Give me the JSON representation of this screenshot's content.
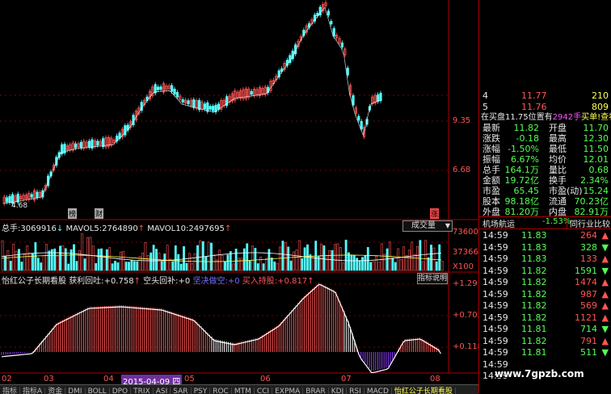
{
  "price_axis": {
    "labels": [
      "9.35",
      "6.68"
    ],
    "low_marker": "4.68"
  },
  "markers": [
    "榜",
    "财",
    "涨"
  ],
  "volume": {
    "header": {
      "total_label": "总手:",
      "total": "3069916",
      "ma5_label": "MAVOL5:",
      "ma5": "2764890",
      "ma10_label": "MAVOL10:",
      "ma10": "2497695"
    },
    "dropdown": "成交量",
    "axis": [
      "73600",
      "37366",
      "X100"
    ]
  },
  "indicator": {
    "header": {
      "name": "怡红公子长期看股",
      "a_label": "获利回吐:",
      "a_val": "+0.758",
      "b_label": "空头回补:",
      "b_val": "+0",
      "c_label": "坚决做空:",
      "c_val": "+0",
      "d_label": "买入持股:",
      "d_val": "+0.817"
    },
    "explain_button": "指标说明",
    "axis": [
      "+1.29",
      "+0.703",
      "+0.118"
    ]
  },
  "date_axis": {
    "labels": [
      "02",
      "03",
      "04",
      "2015-04-09 四",
      "05",
      "06",
      "07",
      "08"
    ]
  },
  "bottom_tabs": [
    "指标",
    "指标A",
    "资金",
    "DMI",
    "BOLL",
    "DPO",
    "TRIX",
    "ASI",
    "SAR",
    "PSY",
    "ROC",
    "MTM",
    "CCI",
    "EXPMA",
    "BRAR",
    "KDJ",
    "RSI",
    "MACD",
    "怡红公子长期看股"
  ],
  "quote": {
    "order_book": [
      {
        "level": "4",
        "price": "11.77",
        "vol": "210"
      },
      {
        "level": "5",
        "price": "11.76",
        "vol": "809"
      }
    ],
    "pending": {
      "text": "在买盘11.75位置有",
      "vol": "2942手",
      "action": "买单!",
      "link": "查看详细"
    },
    "stats": [
      {
        "l1": "最新",
        "v1": "11.82",
        "l2": "开盘",
        "v2": "11.70"
      },
      {
        "l1": "涨跌",
        "v1": "-0.18",
        "l2": "最高",
        "v2": "12.30"
      },
      {
        "l1": "涨幅",
        "v1": "-1.50%",
        "l2": "最低",
        "v2": "11.50"
      },
      {
        "l1": "振幅",
        "v1": "6.67%",
        "l2": "均价",
        "v2": "12.01"
      },
      {
        "l1": "总手",
        "v1": "164.1万",
        "l2": "量比",
        "v2": "0.68"
      },
      {
        "l1": "金额",
        "v1": "19.72亿",
        "l2": "换手",
        "v2": "2.34%"
      },
      {
        "l1": "市盈",
        "v1": "65.45",
        "l2": "市盈(动)",
        "v2": "15.24"
      },
      {
        "l1": "股本",
        "v1": "98.18亿",
        "l2": "流通",
        "v2": "70.23亿"
      },
      {
        "l1": "外盘",
        "v1": "81.20万",
        "l2": "内盘",
        "v2": "82.91万"
      }
    ],
    "sector": {
      "name": "机场航运",
      "change": "-1.53%",
      "compare": "同行业比较"
    },
    "ticks": [
      {
        "time": "14:59",
        "price": "11.83",
        "vol": "264",
        "dir": "up"
      },
      {
        "time": "14:59",
        "price": "11.83",
        "vol": "328",
        "dir": "down"
      },
      {
        "time": "14:59",
        "price": "11.83",
        "vol": "133",
        "dir": "up"
      },
      {
        "time": "14:59",
        "price": "11.82",
        "vol": "1591",
        "dir": "down"
      },
      {
        "time": "14:59",
        "price": "11.82",
        "vol": "1474",
        "dir": "up"
      },
      {
        "time": "14:59",
        "price": "11.82",
        "vol": "987",
        "dir": "up"
      },
      {
        "time": "14:59",
        "price": "11.82",
        "vol": "569",
        "dir": "up"
      },
      {
        "time": "14:59",
        "price": "11.82",
        "vol": "1121",
        "dir": "up"
      },
      {
        "time": "14:59",
        "price": "11.81",
        "vol": "714",
        "dir": "down"
      },
      {
        "time": "14:59",
        "price": "11.82",
        "vol": "791",
        "dir": "up"
      },
      {
        "time": "14:59",
        "price": "11.81",
        "vol": "511",
        "dir": "down"
      },
      {
        "time": "14:59",
        "price": "",
        "vol": "",
        "dir": ""
      },
      {
        "time": "14:59",
        "price": "",
        "vol": "",
        "dir": ""
      }
    ]
  },
  "watermark": "www.7gpzb.com",
  "colors": {
    "up": "#ff5555",
    "down": "#54ffff",
    "bg": "#000000",
    "border": "#aa0000"
  }
}
